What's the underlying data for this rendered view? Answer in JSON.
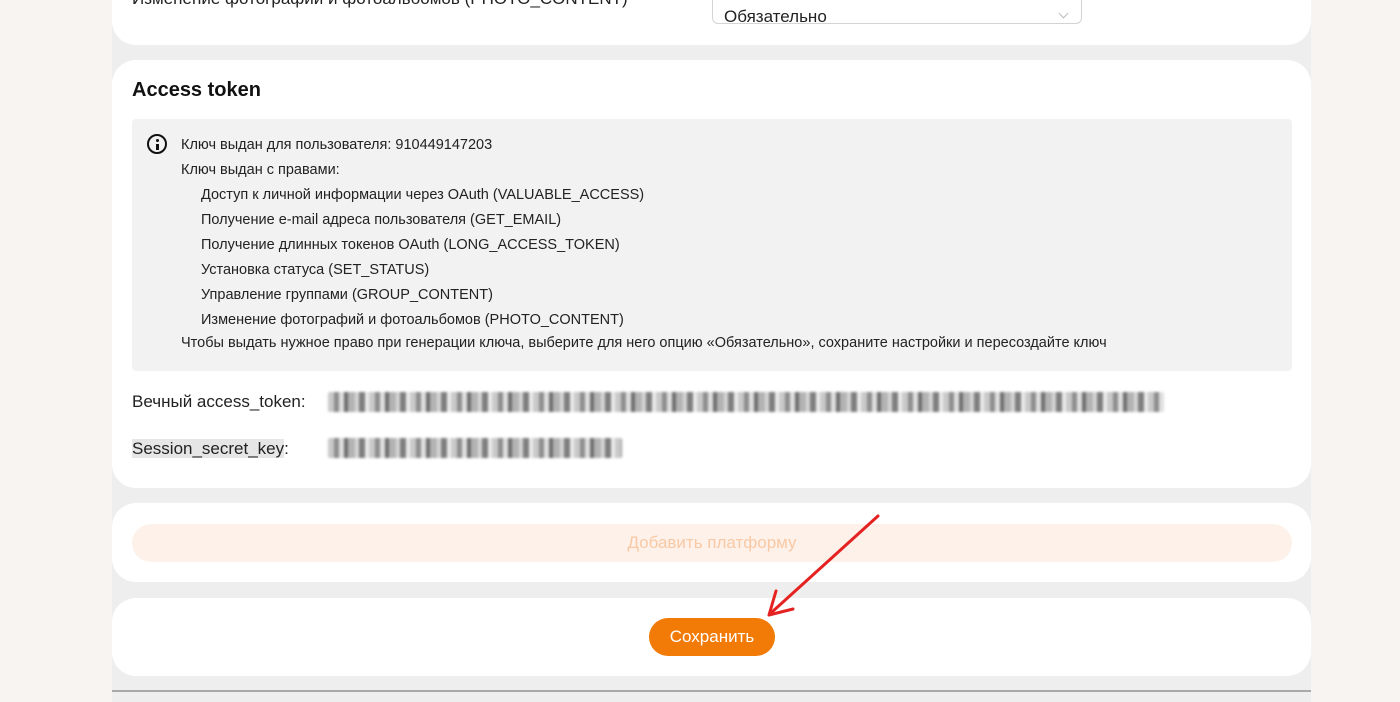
{
  "permission_row": {
    "label": "Изменение фотографий и фотоальбомов (PHOTO_CONTENT)",
    "select_value": "Обязательно"
  },
  "access_token": {
    "title": "Access token",
    "info_icon": "info-icon",
    "info_lines": [
      "Ключ выдан для пользователя: 910449147203",
      "Ключ выдан с правами:",
      "Доступ к личной информации через OAuth (VALUABLE_ACCESS)",
      "Получение e-mail адреса пользователя (GET_EMAIL)",
      "Получение длинных токенов OAuth (LONG_ACCESS_TOKEN)",
      "Установка статуса (SET_STATUS)",
      "Управление группами (GROUP_CONTENT)",
      "Изменение фотографий и фотоальбомов (PHOTO_CONTENT)",
      "Чтобы выдать нужное право при генерации ключа, выберите для него опцию «Обязательно», сохраните настройки и пересоздайте ключ"
    ],
    "eternal_token_label": "Вечный access_token:",
    "session_key_label": "Session_secret_key",
    "session_key_colon": ":"
  },
  "add_platform_label": "Добавить платформу",
  "save_label": "Сохранить",
  "colors": {
    "accent": "#f27a06",
    "annotation_arrow": "#e52222"
  }
}
